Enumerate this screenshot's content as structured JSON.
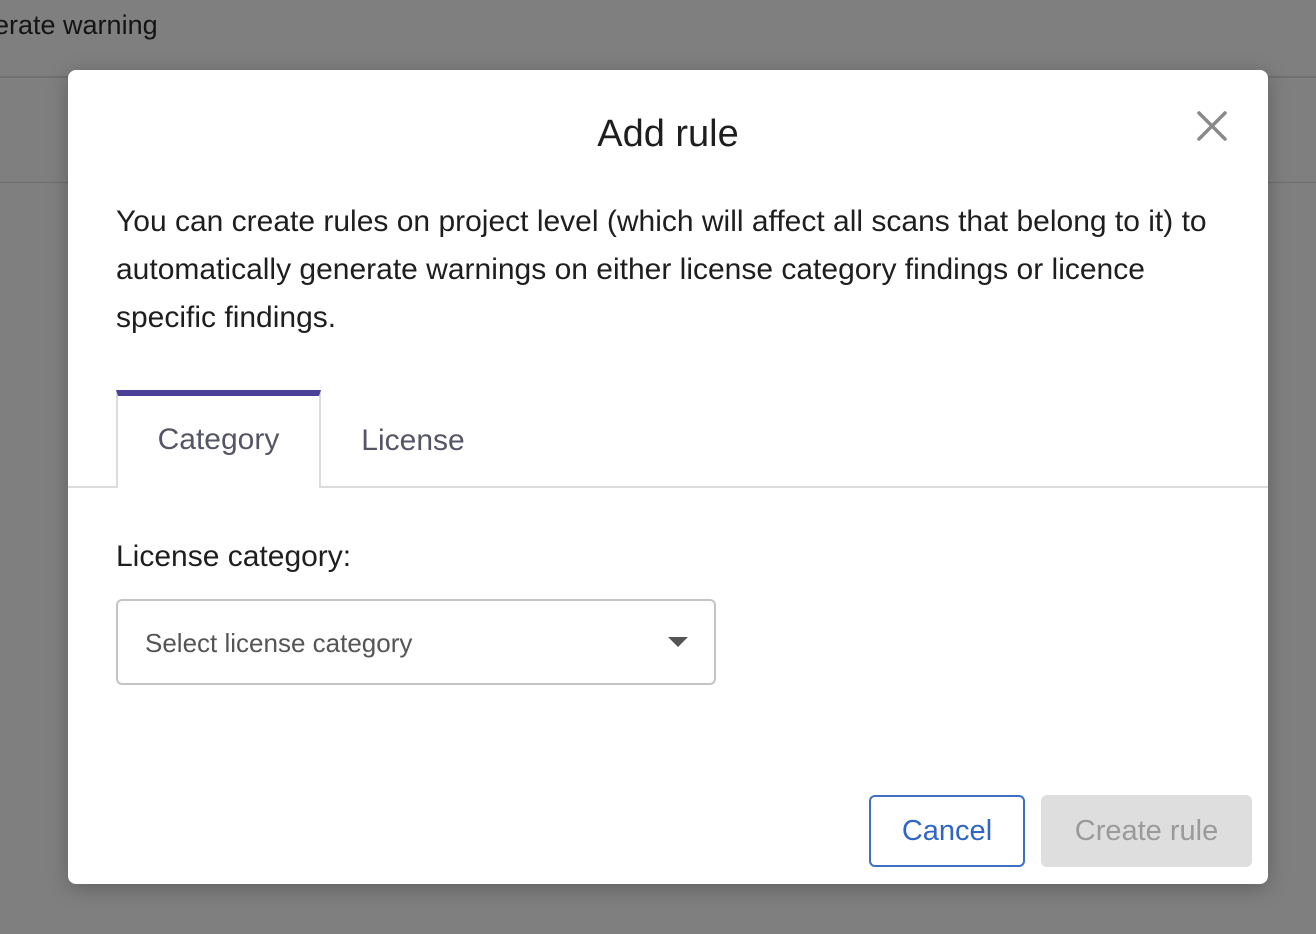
{
  "background": {
    "header_text": "erate warning"
  },
  "modal": {
    "title": "Add rule",
    "close_icon": "close-icon",
    "description": "You can create rules on project level (which will affect all scans that belong to it) to automatically generate warnings on either license category findings or licence specific findings.",
    "tabs": [
      {
        "label": "Category",
        "active": true
      },
      {
        "label": "License",
        "active": false
      }
    ],
    "field": {
      "label": "License category:",
      "placeholder": "Select license category"
    },
    "buttons": {
      "cancel": "Cancel",
      "create": "Create rule"
    }
  },
  "colors": {
    "accent": "#4a4098",
    "link": "#2f66c5",
    "disabled_bg": "#dedede",
    "disabled_text": "#9a9a9a",
    "backdrop": "#7f7f7f"
  }
}
